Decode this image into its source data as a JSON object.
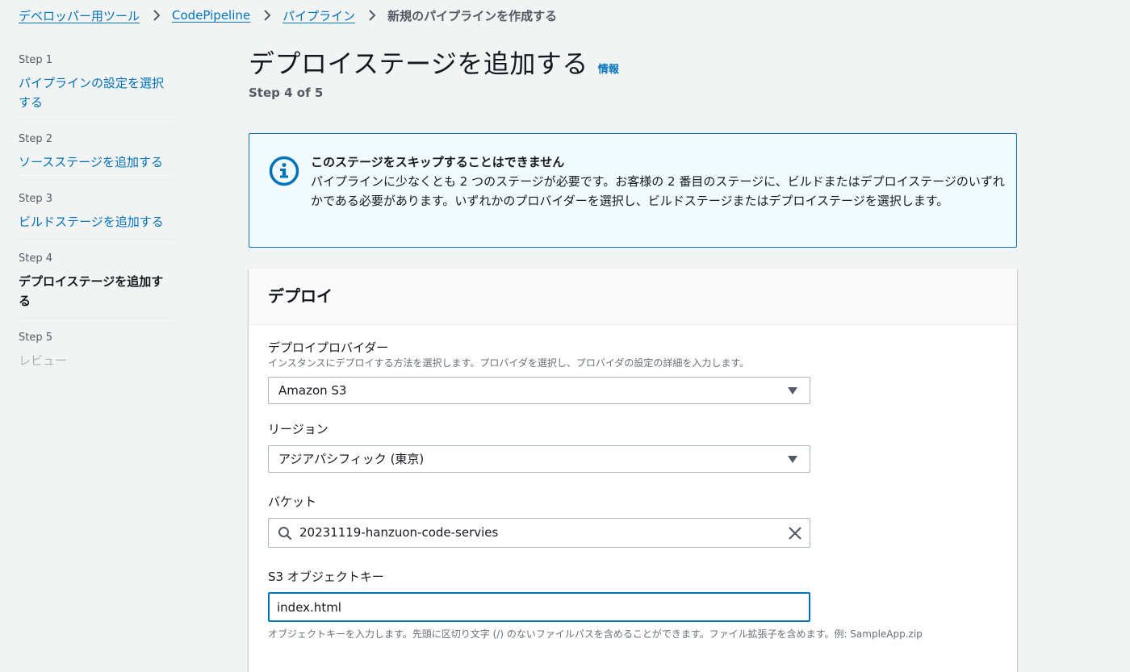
{
  "breadcrumb": {
    "items": [
      "デベロッパー用ツール",
      "CodePipeline",
      "パイプライン"
    ],
    "current": "新規のパイプラインを作成する"
  },
  "steps": [
    {
      "number": "Step 1",
      "label": "パイプラインの設定を選択する",
      "state": "link"
    },
    {
      "number": "Step 2",
      "label": "ソースステージを追加する",
      "state": "link"
    },
    {
      "number": "Step 3",
      "label": "ビルドステージを追加する",
      "state": "link"
    },
    {
      "number": "Step 4",
      "label": "デプロイステージを追加する",
      "state": "active"
    },
    {
      "number": "Step 5",
      "label": "レビュー",
      "state": "disabled"
    }
  ],
  "page": {
    "title": "デプロイステージを追加する",
    "info_link": "情報",
    "step_indicator": "Step 4 of 5"
  },
  "alert": {
    "icon": "info-icon",
    "title": "このステージをスキップすることはできません",
    "body": "パイプラインに少なくとも 2 つのステージが必要です。お客様の 2 番目のステージに、ビルドまたはデプロイステージのいずれかである必要があります。いずれかのプロバイダーを選択し、ビルドステージまたはデプロイステージを選択します。"
  },
  "deploy": {
    "title": "デプロイ",
    "provider": {
      "label": "デプロイプロバイダー",
      "description": "インスタンスにデプロイする方法を選択します。プロバイダを選択し、プロバイダの設定の詳細を入力します。",
      "value": "Amazon S3"
    },
    "region": {
      "label": "リージョン",
      "value": "アジアパシフィック (東京)"
    },
    "bucket": {
      "label": "バケット",
      "value": "20231119-hanzuon-code-servies"
    },
    "object_key": {
      "label": "S3 オブジェクトキー",
      "value": "index.html",
      "hint": "オブジェクトキーを入力します。先頭に区切り文字 (/) のないファイルパスを含めることができます。ファイル拡張子を含めます。例: SampleApp.zip"
    }
  },
  "colors": {
    "link": "#0073bb",
    "alert_bg": "#f1faff",
    "page_bg": "#f2f3f3"
  }
}
